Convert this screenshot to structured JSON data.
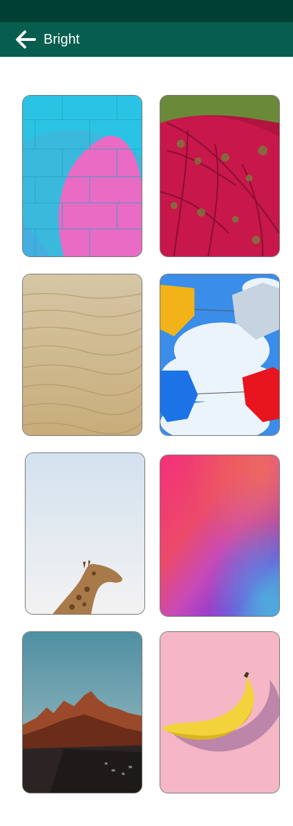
{
  "app_bar": {
    "title": "Bright",
    "back_icon": "arrow-left-icon"
  },
  "colors": {
    "status_bar": "#003f33",
    "app_bar": "#075e4f",
    "title_text": "#ffffff"
  },
  "wallpapers": [
    {
      "subject": "pink-blue-brick-wall"
    },
    {
      "subject": "red-caladium-leaf"
    },
    {
      "subject": "sand-dunes"
    },
    {
      "subject": "umbrellas-sky"
    },
    {
      "subject": "giraffe"
    },
    {
      "subject": "pink-purple-gradient"
    },
    {
      "subject": "mountain-sunset"
    },
    {
      "subject": "banana-on-pink"
    }
  ]
}
